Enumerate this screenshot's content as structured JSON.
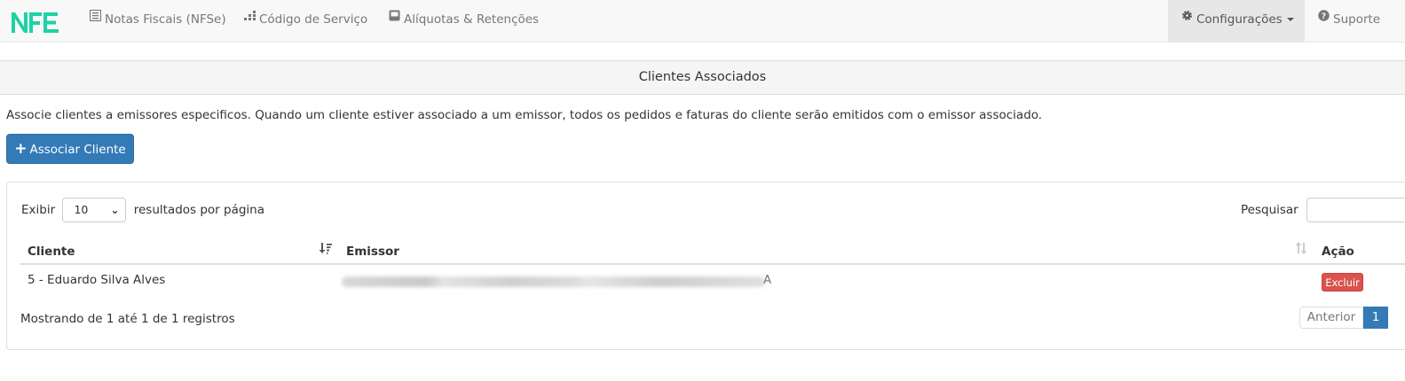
{
  "brand": {
    "logo_text": "NFE",
    "logo_color": "#1fd1a5"
  },
  "nav": {
    "items": [
      {
        "label": "Notas Fiscais (NFSe)",
        "icon": "list-alt-icon"
      },
      {
        "label": "Código de Serviço",
        "icon": "tasks-icon"
      },
      {
        "label": "Alíquotas & Retenções",
        "icon": "inbox-icon"
      }
    ],
    "right": [
      {
        "label": "Configurações",
        "icon": "cog-icon",
        "dropdown": true,
        "active": true
      },
      {
        "label": "Suporte",
        "icon": "question-circle-icon"
      }
    ]
  },
  "panel": {
    "title": "Clientes Associados"
  },
  "description": "Associe clientes a emissores especificos. Quando um cliente estiver associado a um emissor, todos os pedidos e faturas do cliente serão emitidos com o emissor associado.",
  "add_button": {
    "label": "Associar Cliente",
    "icon": "plus-icon"
  },
  "table": {
    "length": {
      "prefix": "Exibir",
      "value": "10",
      "suffix": "resultados por página"
    },
    "search": {
      "label": "Pesquisar",
      "value": ""
    },
    "columns": [
      "Cliente",
      "Emissor",
      "Ação"
    ],
    "rows": [
      {
        "cliente": "5 - Eduardo Silva Alves",
        "emissor_visible_end": "A",
        "action": "Excluir"
      }
    ],
    "info": "Mostrando de 1 até 1 de 1 registros",
    "pagination": {
      "previous": "Anterior",
      "current": "1"
    }
  },
  "colors": {
    "primary": "#337ab7",
    "danger": "#d9534f",
    "navbar_bg": "#f8f8f8"
  }
}
